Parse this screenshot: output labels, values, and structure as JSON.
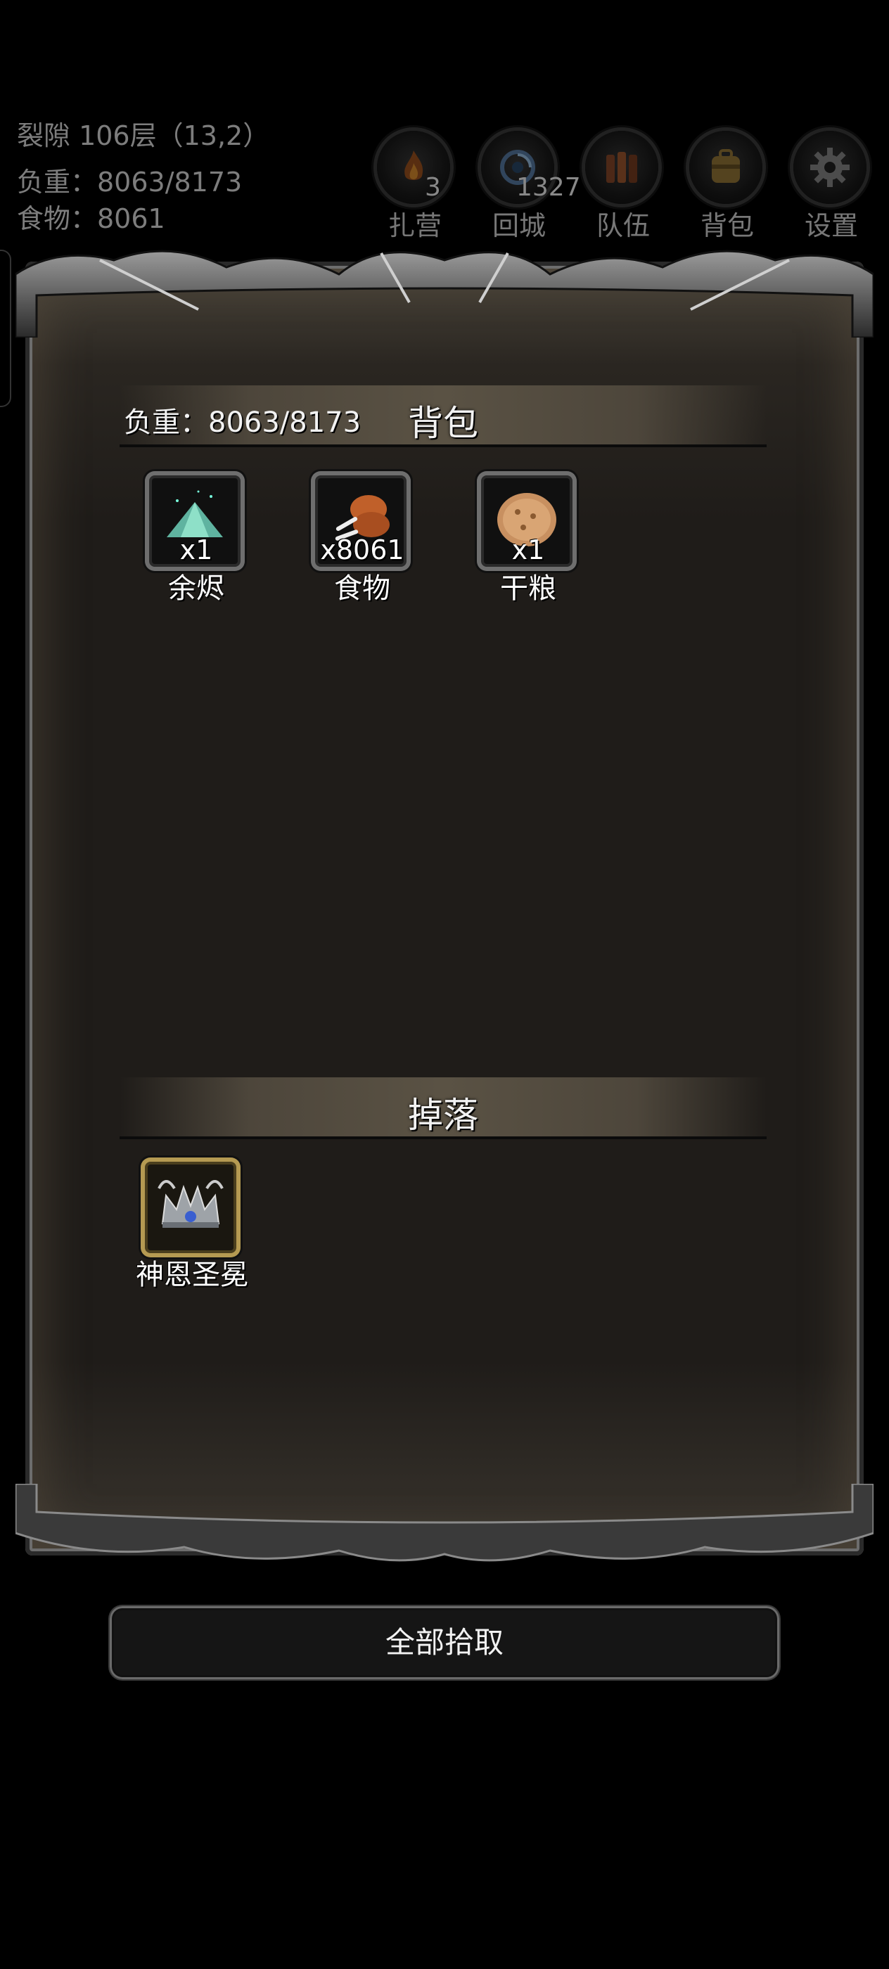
{
  "status": {
    "location": "裂隙 106层（13,2）",
    "load": "负重：8063/8173",
    "food": "食物：8061"
  },
  "top_buttons": [
    {
      "label": "扎营",
      "count": "3",
      "icon": "campfire-icon"
    },
    {
      "label": "回城",
      "count": "1327",
      "icon": "portal-icon"
    },
    {
      "label": "队伍",
      "count": "",
      "icon": "team-icon"
    },
    {
      "label": "背包",
      "count": "",
      "icon": "backpack-icon"
    },
    {
      "label": "设置",
      "count": "",
      "icon": "gear-icon"
    }
  ],
  "backpack": {
    "title": "背包",
    "load": "负重：8063/8173",
    "items": [
      {
        "name": "余烬",
        "qty": "x1",
        "icon": "ember-icon"
      },
      {
        "name": "食物",
        "qty": "x8061",
        "icon": "drumstick-icon"
      },
      {
        "name": "干粮",
        "qty": "x1",
        "icon": "bread-icon"
      }
    ]
  },
  "drops": {
    "title": "掉落",
    "items": [
      {
        "name": "神恩圣冕",
        "icon": "crown-icon"
      }
    ]
  },
  "pick_all_label": "全部拾取"
}
